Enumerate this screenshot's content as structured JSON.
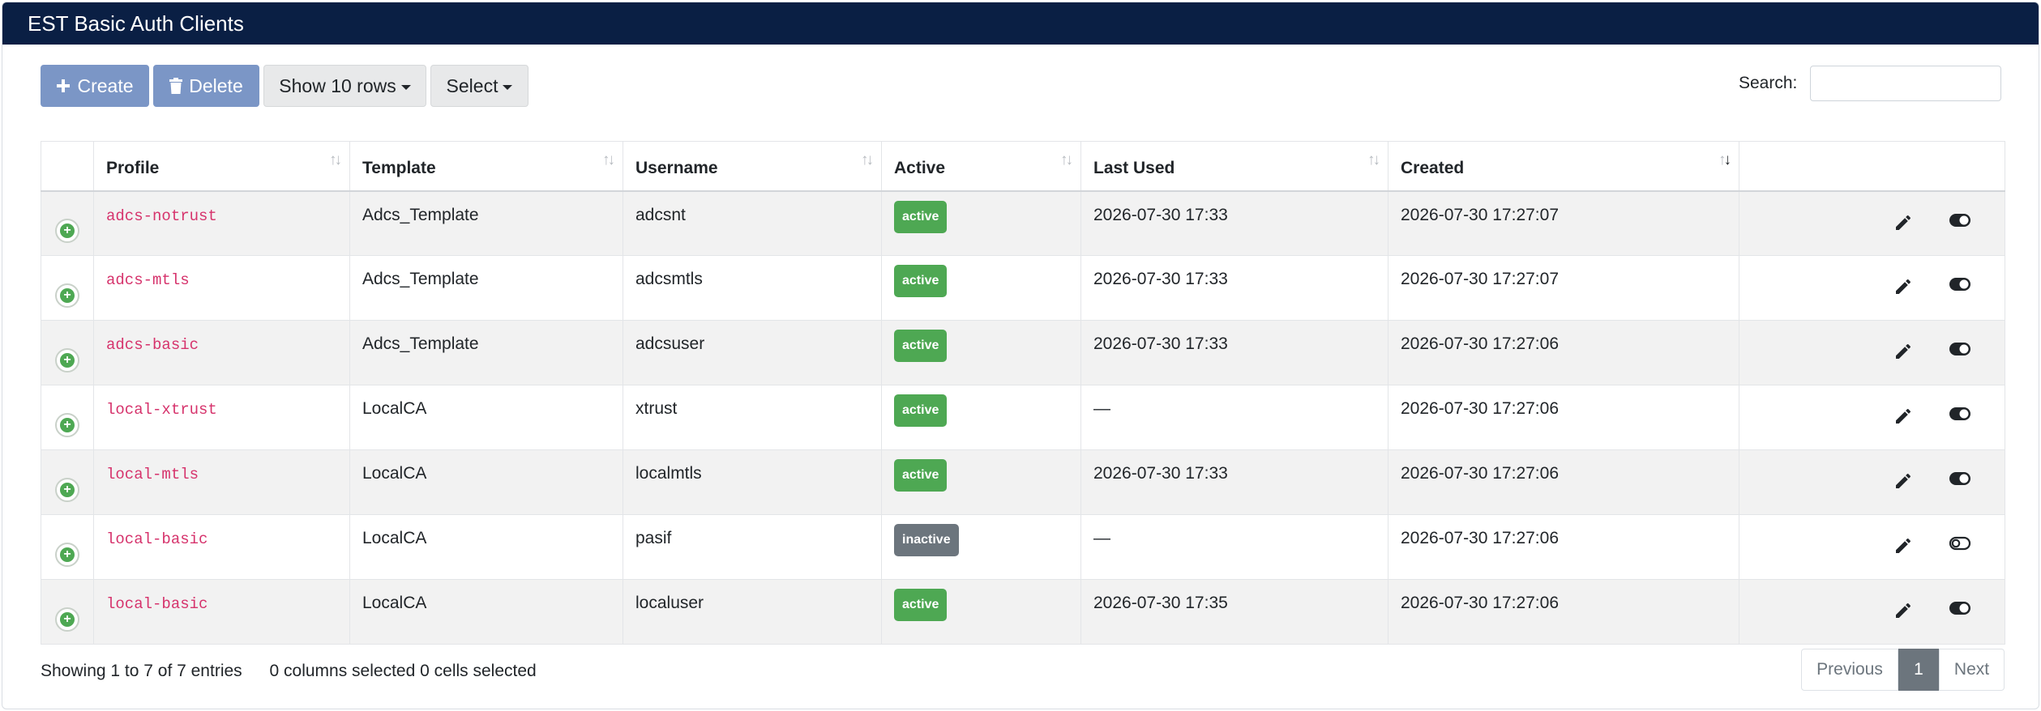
{
  "header": {
    "title": "EST Basic Auth Clients"
  },
  "toolbar": {
    "create_label": "Create",
    "delete_label": "Delete",
    "rows_label": "Show 10 rows",
    "select_label": "Select"
  },
  "search": {
    "label": "Search:",
    "value": ""
  },
  "table": {
    "columns": [
      "Profile",
      "Template",
      "Username",
      "Active",
      "Last Used",
      "Created"
    ],
    "sorted_column": "Created",
    "sort_direction": "descending",
    "rows": [
      {
        "profile": "adcs-notrust",
        "template": "Adcs_Template",
        "username": "adcsnt",
        "status": "active",
        "last_used": "2026-07-30 17:33",
        "created": "2026-07-30 17:27:07",
        "enabled": true
      },
      {
        "profile": "adcs-mtls",
        "template": "Adcs_Template",
        "username": "adcsmtls",
        "status": "active",
        "last_used": "2026-07-30 17:33",
        "created": "2026-07-30 17:27:07",
        "enabled": true
      },
      {
        "profile": "adcs-basic",
        "template": "Adcs_Template",
        "username": "adcsuser",
        "status": "active",
        "last_used": "2026-07-30 17:33",
        "created": "2026-07-30 17:27:06",
        "enabled": true
      },
      {
        "profile": "local-xtrust",
        "template": "LocalCA",
        "username": "xtrust",
        "status": "active",
        "last_used": "—",
        "created": "2026-07-30 17:27:06",
        "enabled": true
      },
      {
        "profile": "local-mtls",
        "template": "LocalCA",
        "username": "localmtls",
        "status": "active",
        "last_used": "2026-07-30 17:33",
        "created": "2026-07-30 17:27:06",
        "enabled": true
      },
      {
        "profile": "local-basic",
        "template": "LocalCA",
        "username": "pasif",
        "status": "inactive",
        "last_used": "—",
        "created": "2026-07-30 17:27:06",
        "enabled": false
      },
      {
        "profile": "local-basic",
        "template": "LocalCA",
        "username": "localuser",
        "status": "active",
        "last_used": "2026-07-30 17:35",
        "created": "2026-07-30 17:27:06",
        "enabled": true
      }
    ]
  },
  "footer": {
    "info": "Showing 1 to 7 of 7 entries",
    "columns_selected": "0 columns selected",
    "cells_selected": "0 cells selected"
  },
  "pagination": {
    "previous": "Previous",
    "current": "1",
    "next": "Next"
  },
  "colors": {
    "header_bg": "#0a1f44",
    "primary_button": "#7b96c6",
    "badge_active": "#4ea853",
    "badge_inactive": "#6c757d",
    "profile_text": "#d6336c"
  },
  "icons": {
    "create": "plus-icon",
    "delete": "trash-icon",
    "expand": "plus-circle-icon",
    "edit": "pencil-icon",
    "enabled": "toggle-on-icon",
    "disabled": "toggle-off-icon",
    "sort": "sort-arrows-icon"
  }
}
